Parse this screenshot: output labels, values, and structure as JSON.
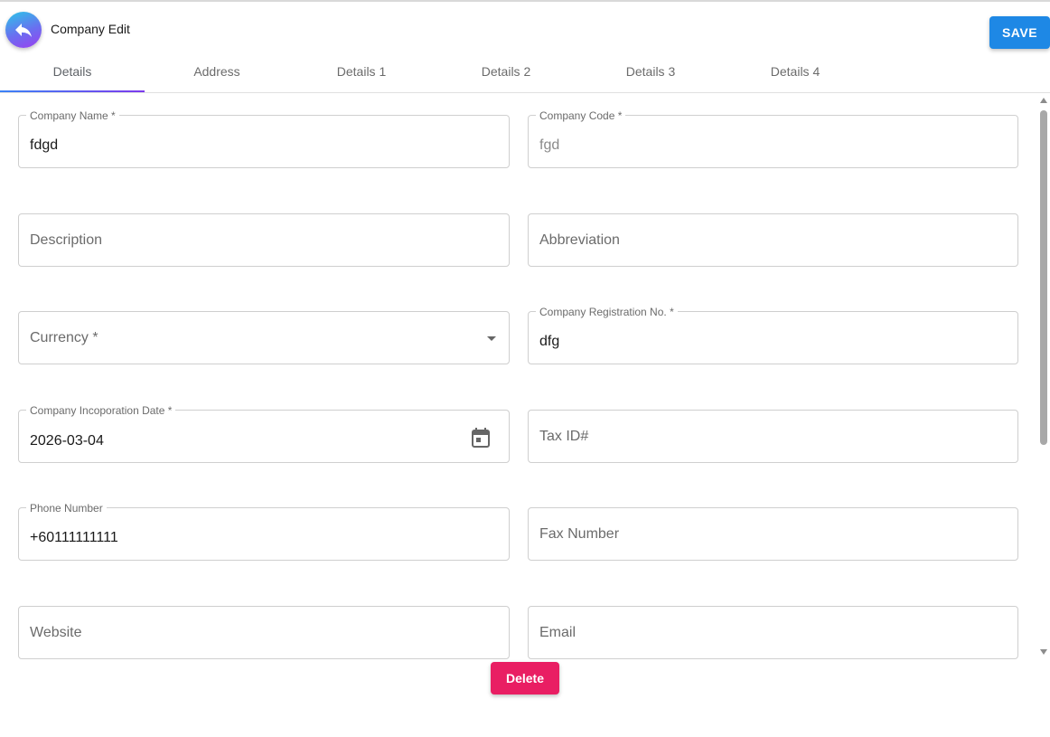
{
  "header": {
    "title": "Company Edit",
    "save_label": "SAVE",
    "back_icon": "reply-arrow-icon"
  },
  "tabs": [
    {
      "label": "Details",
      "active": true
    },
    {
      "label": "Address",
      "active": false
    },
    {
      "label": "Details 1",
      "active": false
    },
    {
      "label": "Details 2",
      "active": false
    },
    {
      "label": "Details 3",
      "active": false
    },
    {
      "label": "Details 4",
      "active": false
    }
  ],
  "form": {
    "company_name": {
      "label": "Company Name *",
      "value": "fdgd"
    },
    "company_code": {
      "label": "Company Code *",
      "value": "fgd"
    },
    "description": {
      "placeholder": "Description"
    },
    "abbreviation": {
      "placeholder": "Abbreviation"
    },
    "currency": {
      "placeholder": "Currency *"
    },
    "registration_no": {
      "label": "Company Registration No. *",
      "value": "dfg"
    },
    "incorporation_date": {
      "label": "Company Incoporation Date *",
      "value": "2026-03-04"
    },
    "tax_id": {
      "placeholder": "Tax ID#"
    },
    "phone": {
      "label": "Phone Number",
      "value": "+60111111111"
    },
    "fax": {
      "placeholder": "Fax Number"
    },
    "website": {
      "placeholder": "Website"
    },
    "email": {
      "placeholder": "Email"
    }
  },
  "actions": {
    "delete_label": "Delete"
  },
  "colors": {
    "save": "#1e88e5",
    "delete": "#e91e63",
    "tab_indicator_start": "#3b82f6",
    "tab_indicator_end": "#7c3aed"
  }
}
